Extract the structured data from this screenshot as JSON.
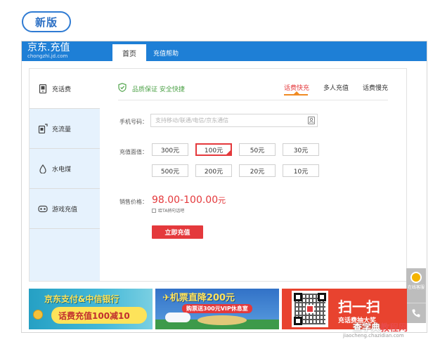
{
  "version_label": "新版",
  "header": {
    "logo_main": "京东.充值",
    "logo_sub": "chongzhi.jd.com",
    "nav": {
      "home": "首页",
      "help": "充值帮助"
    }
  },
  "sidebar": {
    "items": [
      {
        "label": "充话费",
        "icon": "phone-icon"
      },
      {
        "label": "充流量",
        "icon": "data-icon"
      },
      {
        "label": "水电煤",
        "icon": "water-drop-icon"
      },
      {
        "label": "游戏充值",
        "icon": "gamepad-icon"
      }
    ]
  },
  "main": {
    "quality": "品质保证 安全快捷",
    "tabs": [
      "话费快充",
      "多人充值",
      "话费慢充"
    ],
    "phone_label": "手机号码：",
    "phone_placeholder": "支持移动/联通/电信/京东通信",
    "denom_label": "充值面值：",
    "denominations": [
      "300元",
      "100元",
      "50元",
      "30元",
      "500元",
      "200元",
      "20元",
      "10元"
    ],
    "price_label": "销售价格：",
    "price_value": "98.00-100.00",
    "price_unit": "元",
    "checkbox_label": "给TA捎句话吧",
    "submit_label": "立即充值"
  },
  "banners": {
    "b1_line1": "京东支付&中信银行",
    "b1_line2": "话费充值100减10",
    "b2_line1": "✈机票直降200元",
    "b2_line2": "购票送300元VIP休息室",
    "b3_line1": "扫一扫",
    "b3_line2": "充话费抽大奖"
  },
  "float_widget": {
    "chat_label": "在线客服"
  },
  "watermark": {
    "line1_a": "查字典",
    "line1_b": "教程网",
    "line2": "jiaocheng.chazidian.com"
  },
  "colors": {
    "brand_blue": "#1e7fd6",
    "accent_red": "#e4393c",
    "sidebar_bg": "#e6f2fd"
  }
}
